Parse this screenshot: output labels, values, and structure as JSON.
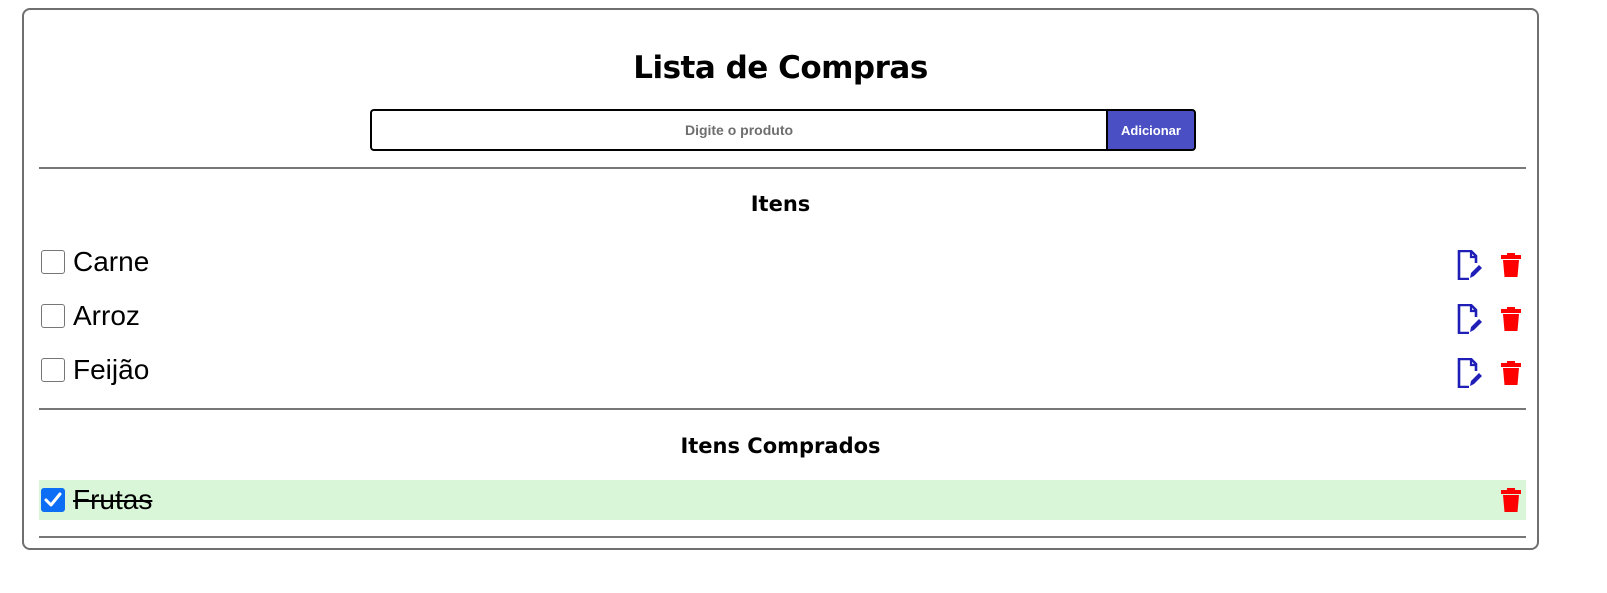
{
  "header": {
    "title": "Lista de Compras"
  },
  "form": {
    "placeholder": "Digite o produto",
    "value": "",
    "add_label": "Adicionar"
  },
  "pending": {
    "title": "Itens",
    "items": [
      {
        "label": "Carne",
        "checked": false
      },
      {
        "label": "Arroz",
        "checked": false
      },
      {
        "label": "Feijão",
        "checked": false
      }
    ]
  },
  "bought": {
    "title": "Itens Comprados",
    "items": [
      {
        "label": "Frutas",
        "checked": true
      }
    ]
  },
  "colors": {
    "accent": "#4a50c4",
    "edit": "#1f1fb8",
    "delete": "#ff0000",
    "bought_bg": "#d9f6d9",
    "checkbox_checked": "#0b6ef5"
  },
  "icons": {
    "edit": "edit-document-icon",
    "delete": "trash-icon",
    "check": "checkmark-icon"
  }
}
